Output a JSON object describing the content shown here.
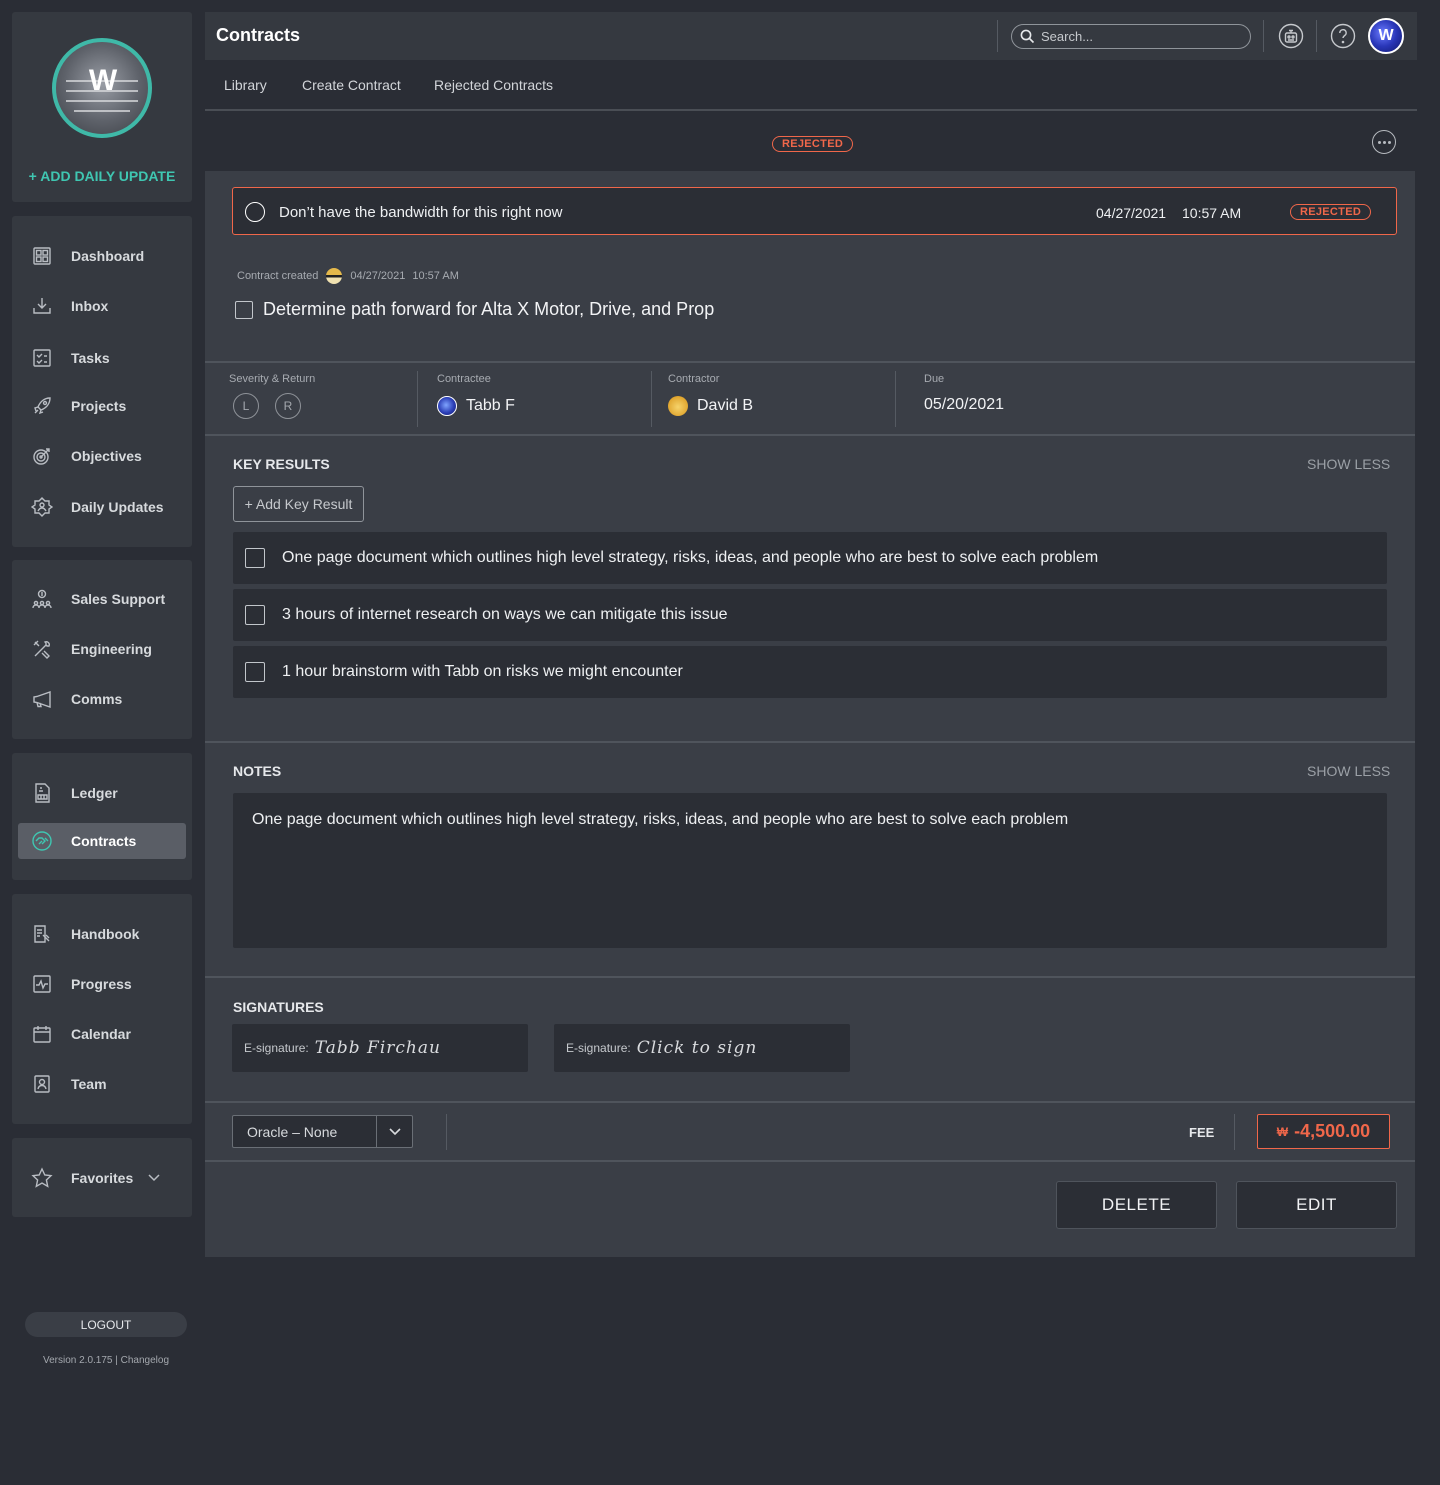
{
  "app": {
    "title": "Contracts"
  },
  "sidebar": {
    "add_daily_update": "+ ADD DAILY UPDATE",
    "groups": [
      [
        {
          "label": "Dashboard",
          "icon": "dashboard-icon"
        },
        {
          "label": "Inbox",
          "icon": "inbox-icon"
        },
        {
          "label": "Tasks",
          "icon": "tasks-icon"
        },
        {
          "label": "Projects",
          "icon": "rocket-icon"
        },
        {
          "label": "Objectives",
          "icon": "target-icon"
        },
        {
          "label": "Daily Updates",
          "icon": "daily-updates-icon"
        }
      ],
      [
        {
          "label": "Sales Support",
          "icon": "sales-support-icon"
        },
        {
          "label": "Engineering",
          "icon": "tools-icon"
        },
        {
          "label": "Comms",
          "icon": "megaphone-icon"
        }
      ],
      [
        {
          "label": "Ledger",
          "icon": "ledger-icon"
        },
        {
          "label": "Contracts",
          "icon": "handshake-icon",
          "active": true
        }
      ],
      [
        {
          "label": "Handbook",
          "icon": "handbook-icon"
        },
        {
          "label": "Progress",
          "icon": "progress-icon"
        },
        {
          "label": "Calendar",
          "icon": "calendar-icon"
        },
        {
          "label": "Team",
          "icon": "team-icon"
        }
      ]
    ],
    "favorites": "Favorites",
    "logout": "LOGOUT",
    "version": "Version 2.0.175 | Changelog"
  },
  "header": {
    "search_placeholder": "Search..."
  },
  "tabs": [
    "Library",
    "Create Contract",
    "Rejected Contracts"
  ],
  "contract": {
    "status": "REJECTED",
    "rejection": {
      "message": "Don’t have the bandwidth for this right now",
      "date": "04/27/2021",
      "time": "10:57 AM",
      "status": "REJECTED"
    },
    "created_label": "Contract created",
    "created_date": "04/27/2021",
    "created_time": "10:57 AM",
    "title": "Determine path forward for Alta X Motor, Drive, and Prop",
    "severity_label": "Severity & Return",
    "severity_l": "L",
    "severity_r": "R",
    "contractee_label": "Contractee",
    "contractee": "Tabb F",
    "contractor_label": "Contractor",
    "contractor": "David B",
    "due_label": "Due",
    "due": "05/20/2021"
  },
  "key_results": {
    "heading": "KEY RESULTS",
    "toggle": "SHOW LESS",
    "add_label": "+ Add Key Result",
    "items": [
      "One page document which outlines high level strategy, risks, ideas, and people who are best to solve each problem",
      "3 hours of internet research on ways we can mitigate this issue",
      "1 hour brainstorm with Tabb on risks we might encounter"
    ]
  },
  "notes": {
    "heading": "NOTES",
    "toggle": "SHOW LESS",
    "text": "One page document which outlines high level strategy, risks, ideas, and people who are best to solve each problem"
  },
  "signatures": {
    "heading": "SIGNATURES",
    "label": "E-signature:",
    "first": "Tabb Firchau",
    "second": "Click to sign"
  },
  "footer": {
    "oracle": "Oracle – None",
    "fee_label": "FEE",
    "fee_currency": "₩",
    "fee_amount": "-4,500.00",
    "delete": "DELETE",
    "edit": "EDIT"
  },
  "colors": {
    "accent_teal": "#3fc6b1",
    "rejected_red": "#f0674a",
    "panel": "#3a3e46",
    "background": "#2a2d35"
  }
}
